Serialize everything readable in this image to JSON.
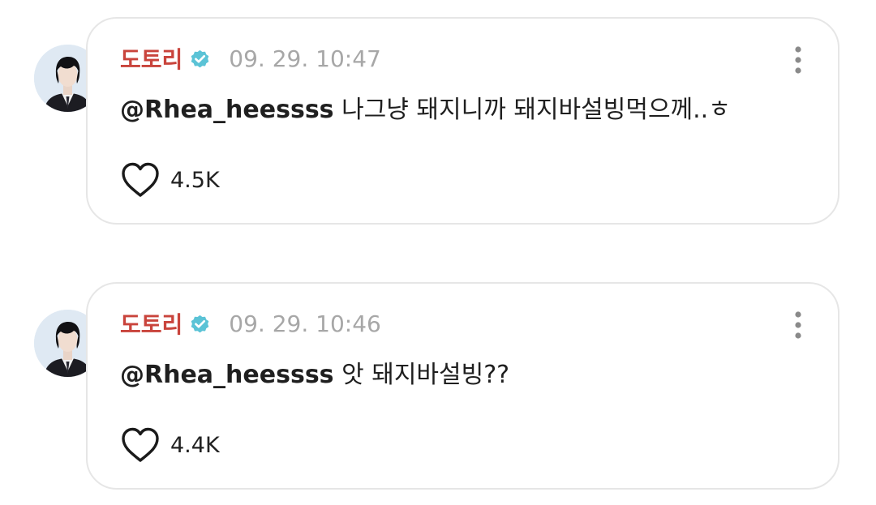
{
  "posts": [
    {
      "author": "도토리",
      "timestamp": "09. 29. 10:47",
      "mention": "@Rhea_heessss",
      "text": "나그냥 돼지니까 돼지바설빙먹으께..ㅎ",
      "likes": "4.5K"
    },
    {
      "author": "도토리",
      "timestamp": "09. 29. 10:46",
      "mention": "@Rhea_heessss",
      "text": "앗 돼지바설빙??",
      "likes": "4.4K"
    }
  ],
  "colors": {
    "author": "#c9443c",
    "verified": "#5bc3d6",
    "timestamp": "#a7a7a7",
    "border": "#e6e6e6"
  },
  "icons": {
    "verified": "verified-badge-icon",
    "like": "heart-icon",
    "menu": "more-vertical-icon"
  }
}
